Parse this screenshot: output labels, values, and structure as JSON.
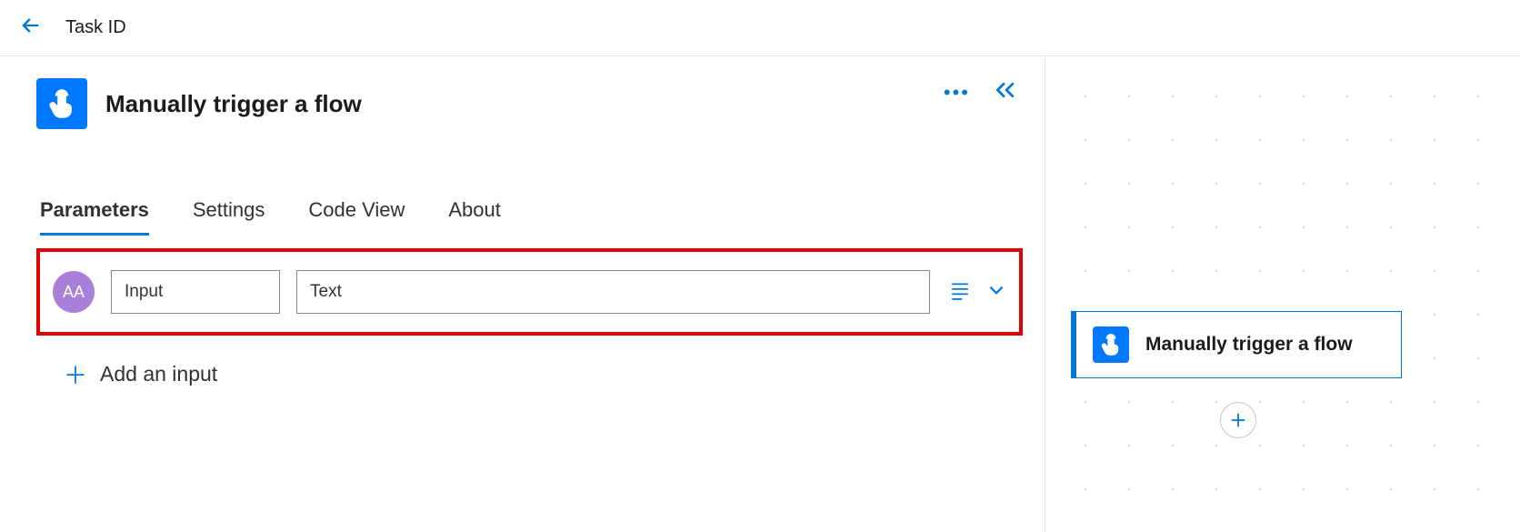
{
  "topbar": {
    "title": "Task ID"
  },
  "panel": {
    "title": "Manually trigger a flow",
    "tabs": [
      "Parameters",
      "Settings",
      "Code View",
      "About"
    ],
    "active_tab": 0,
    "input_row": {
      "type_badge": "AA",
      "name_value": "Input",
      "value_value": "Text"
    },
    "add_input_label": "Add an input"
  },
  "canvas": {
    "card_label": "Manually trigger a flow"
  }
}
